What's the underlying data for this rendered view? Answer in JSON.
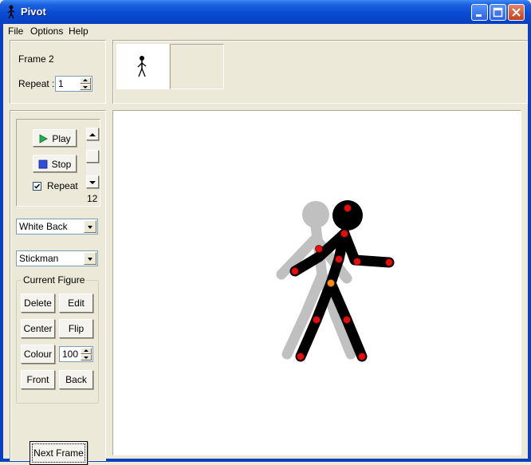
{
  "window": {
    "title": "Pivot"
  },
  "menu": {
    "items": [
      "File",
      "Options",
      "Help"
    ]
  },
  "frame_panel": {
    "frame_label": "Frame 2",
    "repeat_label": "Repeat :",
    "repeat_value": "1"
  },
  "playback": {
    "play_label": "Play",
    "stop_label": "Stop",
    "repeat_checkbox_label": "Repeat",
    "repeat_checked": true,
    "speed_value": "12"
  },
  "background_select": {
    "value": "White Back"
  },
  "figure_type_select": {
    "value": "Stickman"
  },
  "current_figure": {
    "group_label": "Current Figure",
    "delete_label": "Delete",
    "edit_label": "Edit",
    "center_label": "Center",
    "flip_label": "Flip",
    "colour_label": "Colour",
    "colour_value": "100",
    "front_label": "Front",
    "back_label": "Back"
  },
  "next_frame_label": "Next Frame",
  "colors": {
    "titlebar": "#0a4ed6",
    "canvas_bg": "#ffffff",
    "figure_black": "#000000",
    "figure_ghost": "#c0c0c0",
    "joint_red": "#e01010",
    "joint_orange": "#ff8c1a",
    "play_green": "#22b14c",
    "stop_blue": "#2f4fd8"
  }
}
